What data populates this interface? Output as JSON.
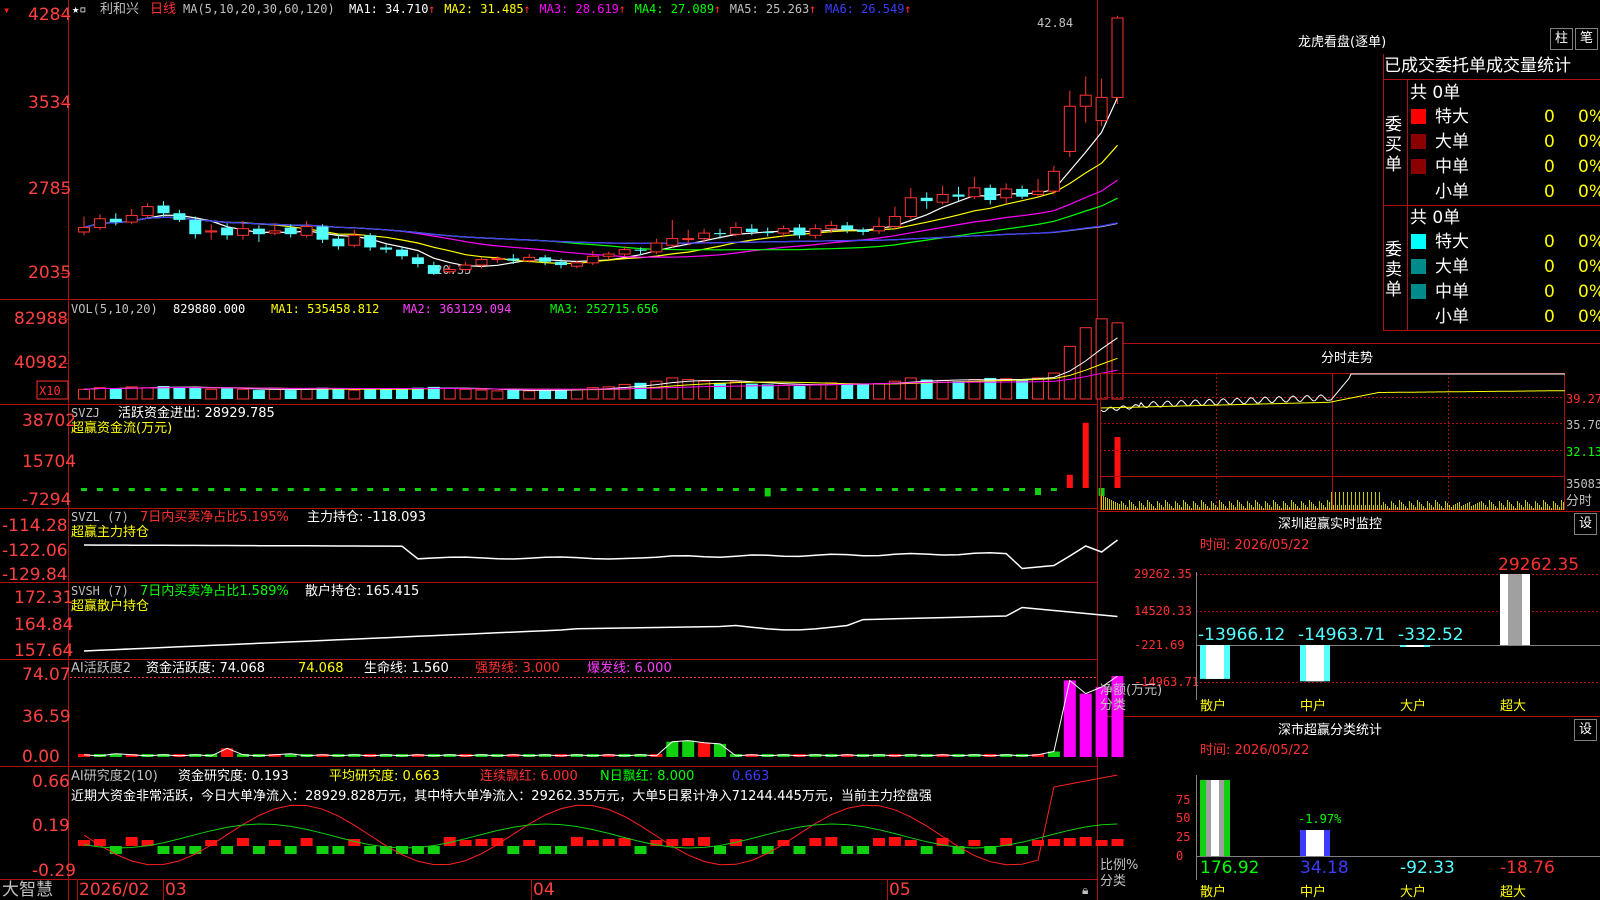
{
  "stock": {
    "name": "利和兴",
    "period": "日线"
  },
  "header": {
    "ma_spec": "MA(5,10,20,30,60,120)",
    "ma": [
      {
        "label": "MA1: 34.710",
        "color": "#ffffff"
      },
      {
        "label": "MA2: 31.485",
        "color": "#ffff00"
      },
      {
        "label": "MA3: 28.619",
        "color": "#ff00ff"
      },
      {
        "label": "MA4: 27.089",
        "color": "#00ff00"
      },
      {
        "label": "MA5: 25.263",
        "color": "#c0c0c0"
      },
      {
        "label": "MA6: 26.549",
        "color": "#3c3cff"
      }
    ]
  },
  "colors": {
    "up": "#ff3232",
    "down": "#54ffff",
    "border": "#b01010",
    "axis_label": "#ff4040"
  },
  "main_chart": {
    "axis_labels": [
      "4284",
      "3534",
      "2785",
      "2035"
    ],
    "high_label": "42.84",
    "low_label": "20.35",
    "candles": [
      [
        24.2,
        24.6,
        25.6,
        23.9
      ],
      [
        24.6,
        25.4,
        25.8,
        24.4
      ],
      [
        25.4,
        25.1,
        25.9,
        24.8
      ],
      [
        25.1,
        25.7,
        26.3,
        24.9
      ],
      [
        25.7,
        26.5,
        26.8,
        25.5
      ],
      [
        26.6,
        25.9,
        27.0,
        25.6
      ],
      [
        25.9,
        25.3,
        26.2,
        25.1
      ],
      [
        25.3,
        24.0,
        25.6,
        23.6
      ],
      [
        24.2,
        24.3,
        24.9,
        23.5
      ],
      [
        24.6,
        23.9,
        25.0,
        23.5
      ],
      [
        23.9,
        24.5,
        25.2,
        23.5
      ],
      [
        24.5,
        24.0,
        24.8,
        23.3
      ],
      [
        24.1,
        24.3,
        25.0,
        23.9
      ],
      [
        24.6,
        24.0,
        24.9,
        23.7
      ],
      [
        23.9,
        24.7,
        25.2,
        23.7
      ],
      [
        24.7,
        23.5,
        24.9,
        23.2
      ],
      [
        23.6,
        22.9,
        24.0,
        22.6
      ],
      [
        23.0,
        23.9,
        24.4,
        22.8
      ],
      [
        23.9,
        22.8,
        24.1,
        22.5
      ],
      [
        22.8,
        22.6,
        23.1,
        22.3
      ],
      [
        22.6,
        22.0,
        22.9,
        21.7
      ],
      [
        21.9,
        21.3,
        22.2,
        21.0
      ],
      [
        21.2,
        20.4,
        21.5,
        20.3
      ],
      [
        20.6,
        20.8,
        21.2,
        20.4
      ],
      [
        20.8,
        21.2,
        21.5,
        20.6
      ],
      [
        21.2,
        21.7,
        21.9,
        20.9
      ],
      [
        21.7,
        21.8,
        22.0,
        21.4
      ],
      [
        21.8,
        21.6,
        22.2,
        21.3
      ],
      [
        21.6,
        21.9,
        22.2,
        21.4
      ],
      [
        21.9,
        21.5,
        22.1,
        21.2
      ],
      [
        21.5,
        21.2,
        21.8,
        20.9
      ],
      [
        21.1,
        21.4,
        21.6,
        20.9
      ],
      [
        21.4,
        22.0,
        22.5,
        21.2
      ],
      [
        22.0,
        22.2,
        22.4,
        21.7
      ],
      [
        22.2,
        22.6,
        22.9,
        21.9
      ],
      [
        22.6,
        22.5,
        22.8,
        22.1
      ],
      [
        22.4,
        23.2,
        23.6,
        22.2
      ],
      [
        23.0,
        23.6,
        25.3,
        22.8
      ],
      [
        23.6,
        23.6,
        24.4,
        23.0
      ],
      [
        23.6,
        24.1,
        24.5,
        23.2
      ],
      [
        24.1,
        24.0,
        24.5,
        23.6
      ],
      [
        24.0,
        24.6,
        25.1,
        23.8
      ],
      [
        24.5,
        24.2,
        24.9,
        23.9
      ],
      [
        24.2,
        24.1,
        24.6,
        23.8
      ],
      [
        24.1,
        24.5,
        24.8,
        23.7
      ],
      [
        24.6,
        23.9,
        24.9,
        23.6
      ],
      [
        23.9,
        24.5,
        24.9,
        23.6
      ],
      [
        24.5,
        24.8,
        25.2,
        24.1
      ],
      [
        24.8,
        24.4,
        25.1,
        24.1
      ],
      [
        24.4,
        24.2,
        24.6,
        23.9
      ],
      [
        24.3,
        24.7,
        25.5,
        24.0
      ],
      [
        24.7,
        25.6,
        26.5,
        24.5
      ],
      [
        25.6,
        27.3,
        28.2,
        25.4
      ],
      [
        27.3,
        27.0,
        27.8,
        26.3
      ],
      [
        26.9,
        27.6,
        28.4,
        26.7
      ],
      [
        27.6,
        27.4,
        28.3,
        27.0
      ],
      [
        27.4,
        28.2,
        29.2,
        27.2
      ],
      [
        28.2,
        27.1,
        28.5,
        26.7
      ],
      [
        27.3,
        28.1,
        28.6,
        26.8
      ],
      [
        28.1,
        27.4,
        28.4,
        27.2
      ],
      [
        27.6,
        27.9,
        29.0,
        27.4
      ],
      [
        27.9,
        29.7,
        30.2,
        27.6
      ],
      [
        31.5,
        35.6,
        37.0,
        31.0
      ],
      [
        35.6,
        36.6,
        38.3,
        34.1
      ],
      [
        34.3,
        36.4,
        38.1,
        33.8
      ],
      [
        36.4,
        43.6,
        43.8,
        35.8
      ]
    ]
  },
  "vol_panel": {
    "title": "VOL(5,10,20)",
    "value": "829880.000",
    "ma1": "MA1: 535458.812",
    "ma2": "MA2: 363129.094",
    "ma3": "MA3: 252715.656",
    "axis_labels": [
      "82988",
      "40982"
    ],
    "multiplier": "X10",
    "volumes": [
      12,
      14,
      13,
      15,
      14,
      16,
      15,
      14,
      12,
      13,
      12,
      11,
      12,
      11,
      13,
      14,
      12,
      11,
      13,
      12,
      13,
      14,
      15,
      13,
      12,
      11,
      10,
      11,
      10,
      11,
      12,
      12,
      14,
      15,
      18,
      20,
      22,
      26,
      24,
      22,
      20,
      21,
      19,
      18,
      17,
      16,
      18,
      20,
      19,
      18,
      19,
      22,
      26,
      24,
      23,
      22,
      24,
      26,
      25,
      24,
      26,
      32,
      65,
      88,
      99,
      94
    ]
  },
  "svzj_panel": {
    "title": "SVZJ",
    "label": "活跃资金进出: 28929.785",
    "subtitle": "超赢资金流(万元)",
    "axis_labels": [
      "38702",
      "15704",
      "-7294"
    ],
    "values": [
      -900,
      -700,
      -800,
      -1000,
      -600,
      -800,
      -1200,
      -900,
      -700,
      -800,
      -1100,
      -800,
      -700,
      -600,
      -1000,
      -800,
      -900,
      -700,
      -600,
      -800,
      -700,
      -900,
      -600,
      -800,
      -700,
      -900,
      -800,
      -600,
      -900,
      -700,
      -800,
      -700,
      -600,
      -800,
      -700,
      -900,
      -800,
      -700,
      -600,
      -900,
      -800,
      -700,
      -600,
      -4800,
      -700,
      -900,
      -800,
      -700,
      -600,
      -800,
      -900,
      -700,
      -800,
      -600,
      -700,
      -900,
      -800,
      -700,
      -600,
      -800,
      -4000,
      -900,
      7500,
      37000,
      -4500,
      28900
    ]
  },
  "svzl_panel": {
    "title": "SVZL (7)",
    "label1": "7日内买卖净占比5.195%",
    "label2": "主力持仓: -118.093",
    "subtitle": "超赢主力持仓",
    "axis_labels": [
      "-114.28",
      "-122.06",
      "-129.84"
    ]
  },
  "svsh_panel": {
    "title": "SVSH (7)",
    "label1": "7日内买卖净占比1.589%",
    "label2": "散户持仓: 165.415",
    "subtitle": "超赢散户持仓",
    "axis_labels": [
      "172.31",
      "164.84",
      "157.64"
    ]
  },
  "ai_active_panel": {
    "title": "AI活跃度2",
    "label1": "资金活跃度: 74.068",
    "label2": "74.068",
    "label3": "生命线: 1.560",
    "label4": "强势线: 3.000",
    "label5": "爆发线: 6.000",
    "axis_labels": [
      "74.07",
      "36.59",
      "0.00"
    ],
    "values": [
      2,
      1,
      3,
      2,
      1,
      2,
      1,
      2,
      1,
      8,
      2,
      1,
      2,
      3,
      1,
      2,
      1,
      2,
      1,
      2,
      1,
      2,
      1,
      2,
      1,
      2,
      1,
      2,
      1,
      2,
      1,
      2,
      1,
      2,
      1,
      2,
      1,
      14,
      15,
      13,
      12,
      1,
      2,
      1,
      2,
      1,
      2,
      1,
      2,
      1,
      2,
      1,
      2,
      1,
      2,
      1,
      2,
      1,
      2,
      1,
      2,
      5,
      70,
      58,
      64,
      74
    ]
  },
  "ai_research_panel": {
    "title": "AI研究度2(10)",
    "label1": "资金研究度: 0.193",
    "label2": "平均研究度: 0.663",
    "label3": "连续飘红: 6.000",
    "label4": "N日飘红: 8.000",
    "label5": "0.663",
    "commentary": "近期大资金非常活跃，今日大单净流入：28929.828万元，其中特大单净流入：29262.35万元，大单5日累计净入71244.445万元，当前主力控盘强",
    "axis_labels": [
      "0.66",
      "0.19",
      "-0.29"
    ]
  },
  "date_axis": {
    "labels": [
      "2026/02",
      "03",
      "04",
      "05"
    ]
  },
  "brand": "大智慧",
  "right_panel": {
    "dragon": {
      "title": "龙虎看盘(逐单)",
      "tab_bar": "柱",
      "tab_tick": "笔",
      "heading": "已成交委托单成交量统计",
      "buy": {
        "side_label": "委买单",
        "total": "共 0单",
        "rows": [
          {
            "label": "特大",
            "color": "#ff0000",
            "value": "0",
            "pct": "0%"
          },
          {
            "label": "大单",
            "color": "#8b0000",
            "value": "0",
            "pct": "0%"
          },
          {
            "label": "中单",
            "color": "#8b0000",
            "value": "0",
            "pct": "0%"
          },
          {
            "label": "小单",
            "color": "",
            "value": "0",
            "pct": "0%"
          }
        ]
      },
      "sell": {
        "side_label": "委卖单",
        "total": "共 0单",
        "rows": [
          {
            "label": "特大",
            "color": "#00ffff",
            "value": "0",
            "pct": "0%"
          },
          {
            "label": "大单",
            "color": "#008b8b",
            "value": "0",
            "pct": "0%"
          },
          {
            "label": "中单",
            "color": "#008b8b",
            "value": "0",
            "pct": "0%"
          },
          {
            "label": "小单",
            "color": "",
            "value": "0",
            "pct": "0%"
          }
        ]
      }
    },
    "intraday": {
      "title": "分时走势",
      "price_labels": [
        "39.27",
        "35.70",
        "32.13"
      ],
      "vol_label": "35083",
      "bottom_label": "分时"
    },
    "sz_monitor": {
      "title": "深圳超赢实时监控",
      "settings": "设",
      "time": "时间: 2026/05/22",
      "axis_labels": [
        "29262.35",
        "14520.33",
        "-221.69",
        "-14963.71"
      ],
      "legend1": "净额(万元)",
      "legend2": "分类",
      "categories": [
        "散户",
        "中户",
        "大户",
        "超大"
      ],
      "values": [
        -13966.12,
        -14963.71,
        -332.52,
        29262.35
      ],
      "value_labels": [
        "-13966.12",
        "-14963.71",
        "-332.52",
        "29262.35"
      ]
    },
    "sz_stats": {
      "title": "深市超赢分类统计",
      "settings": "设",
      "time": "时间: 2026/05/22",
      "axis_labels": [
        "75",
        "50",
        "25",
        "0"
      ],
      "legend1": "比例%",
      "legend2": "分类",
      "categories": [
        "散户",
        "中户",
        "大户",
        "超大"
      ],
      "values": [
        176.92,
        34.18,
        -92.33,
        -18.76
      ],
      "value_labels": [
        "176.92",
        "34.18",
        "-92.33",
        "-18.76"
      ],
      "extra_label": "-1.97%"
    }
  }
}
